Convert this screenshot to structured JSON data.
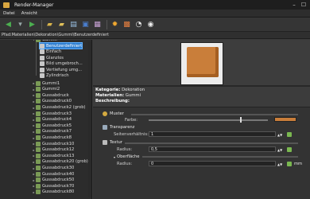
{
  "window": {
    "title": "Render-Manager"
  },
  "menu": {
    "items": [
      "Datei",
      "Ansicht"
    ]
  },
  "toolbar": {
    "buttons": [
      {
        "name": "back-button",
        "icon": "arrow-left-icon",
        "glyph": "◀",
        "color": "#4caf50"
      },
      {
        "name": "dropdown-button",
        "icon": "chevron-down-icon",
        "glyph": "▾",
        "color": "#9aa"
      },
      {
        "name": "forward-button",
        "icon": "arrow-right-icon",
        "glyph": "▶",
        "color": "#4caf50"
      },
      {
        "name": "open-folder-button",
        "icon": "folder-icon",
        "glyph": "▰",
        "color": "#d9b44a"
      },
      {
        "name": "new-folder-button",
        "icon": "folder-new-icon",
        "glyph": "▰",
        "color": "#e0c05a"
      },
      {
        "name": "page-button",
        "icon": "page-icon",
        "glyph": "▤",
        "color": "#9cc3e6"
      },
      {
        "name": "save-button",
        "icon": "disk-icon",
        "glyph": "▣",
        "color": "#4a7fd0"
      },
      {
        "name": "grid-button",
        "icon": "grid-icon",
        "glyph": "▦",
        "color": "#c9a3d6"
      },
      {
        "name": "settings-button",
        "icon": "gear-icon",
        "glyph": "✹",
        "color": "#f0a830"
      },
      {
        "name": "render-button",
        "icon": "render-icon",
        "glyph": "▩",
        "color": "#e88040"
      },
      {
        "name": "refresh-button",
        "icon": "refresh-icon",
        "glyph": "◔",
        "color": "#eeeeee"
      },
      {
        "name": "stop-button",
        "icon": "stop-icon",
        "glyph": "◉",
        "color": "#eeeeee"
      }
    ]
  },
  "breadcrumb": "Pfad:Materialien\\Dekoration\\Gummi\\Benutzerdefiniert",
  "tree": {
    "top_partial": "Gummi",
    "children": [
      "Benutzerdefiniert",
      "Einfach",
      "Glanzlos",
      "Bild umgebroch...",
      "Vertiefung umg...",
      "Zylindrisch"
    ],
    "items": [
      "Gummi1",
      "Gummi2",
      "Gussabdruck",
      "Gussabdruck0",
      "Gussabdruck2 (grob)",
      "Gussabdruck3",
      "Gussabdruck4",
      "Gussabdruck5",
      "Gussabdruck7",
      "Gussabdruck8",
      "Gussabdruck10",
      "Gussabdruck12",
      "Gussabdruck13",
      "Gussabdruck20 (grob)",
      "Gussabdruck30",
      "Gussabdruck40",
      "Gussabdruck50",
      "Gussabdruck70",
      "Gussabdruck80"
    ]
  },
  "info": {
    "category_label": "Kategorie:",
    "category_value": "Dekoration",
    "materials_label": "Materialien:",
    "materials_value": "Gummi",
    "description_label": "Beschreibung:",
    "description_value": ""
  },
  "properties": {
    "muster_label": "Muster",
    "farbe_label": "Farbe:",
    "transparenz_label": "Transparenz",
    "seitenverhaeltnis_label": "Seitenverhältnis:",
    "seitenverhaeltnis_value": "1",
    "textur_label": "Textur",
    "radius_label": "Radius:",
    "radius_value": "0,5",
    "oberflaeche_label": "Oberfläche",
    "radius2_label": "Radius:",
    "radius2_value": "0",
    "unit": "mm",
    "swatch_color": "#c97e3a"
  }
}
